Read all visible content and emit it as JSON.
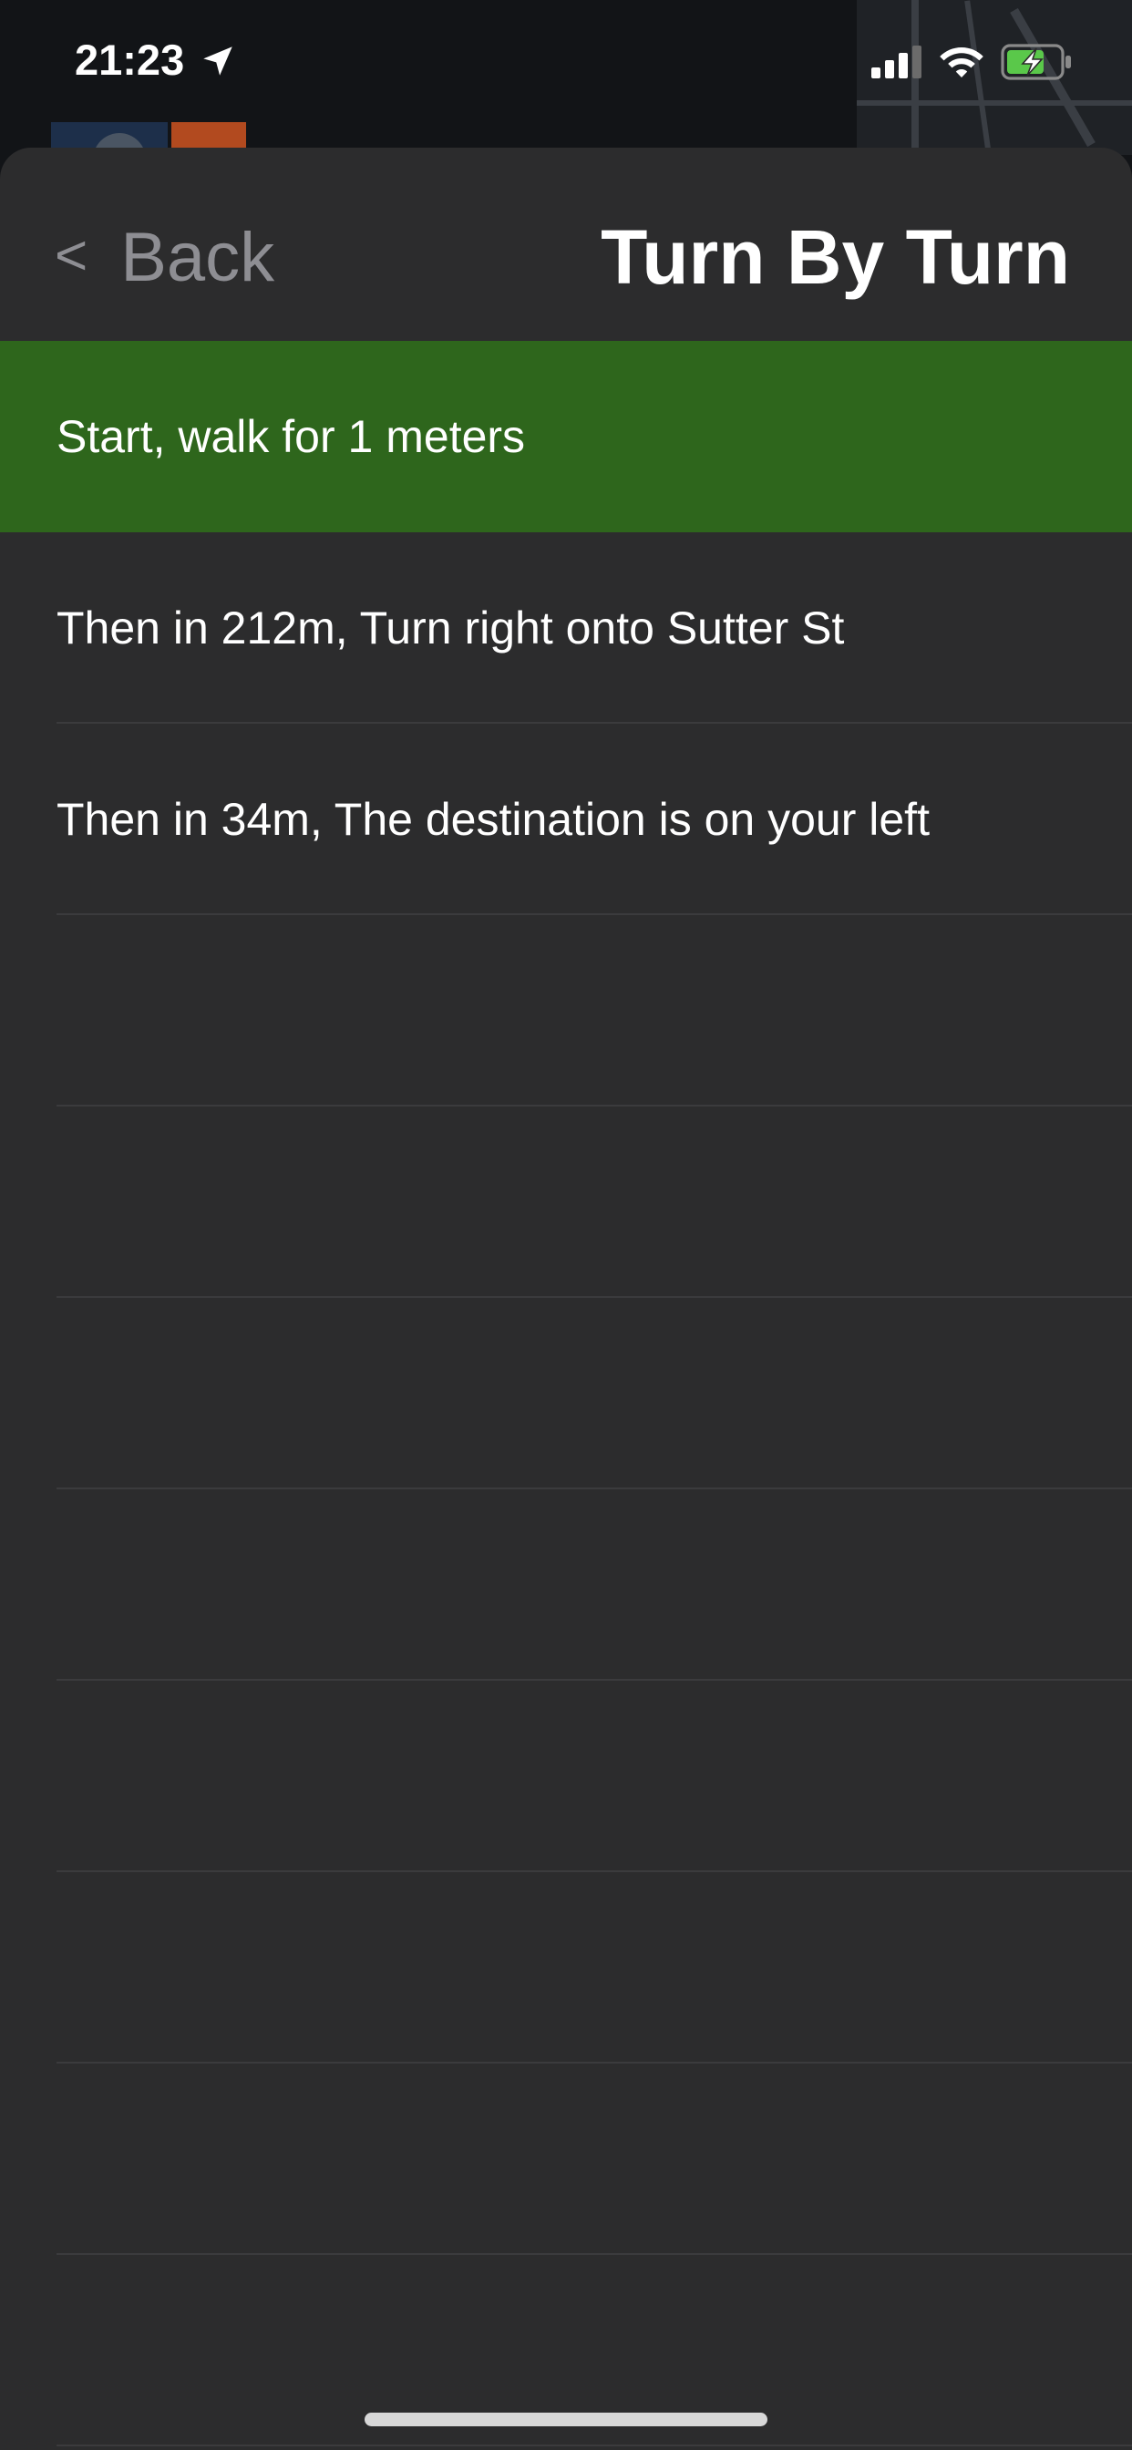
{
  "status_bar": {
    "time": "21:23",
    "icons": [
      "location-arrow-icon",
      "cellular-signal-icon",
      "wifi-icon",
      "battery-charging-icon"
    ],
    "battery_color": "#5ac84a"
  },
  "nav": {
    "back_chevron": "<",
    "back_label": "Back",
    "title": "Turn By Turn"
  },
  "steps": [
    {
      "text": "Start, walk for 1 meters",
      "active": true
    },
    {
      "text": "Then in 212m, Turn right onto Sutter St",
      "active": false
    },
    {
      "text": "Then in 34m, The destination is on your left",
      "active": false
    },
    {
      "text": "",
      "active": false
    },
    {
      "text": "",
      "active": false
    },
    {
      "text": "",
      "active": false
    },
    {
      "text": "",
      "active": false
    },
    {
      "text": "",
      "active": false
    },
    {
      "text": "",
      "active": false
    },
    {
      "text": "",
      "active": false
    },
    {
      "text": "",
      "active": false
    }
  ],
  "colors": {
    "active_step": "#2e661c",
    "sheet": "#2c2c2d",
    "back_text": "#8e8e93"
  }
}
